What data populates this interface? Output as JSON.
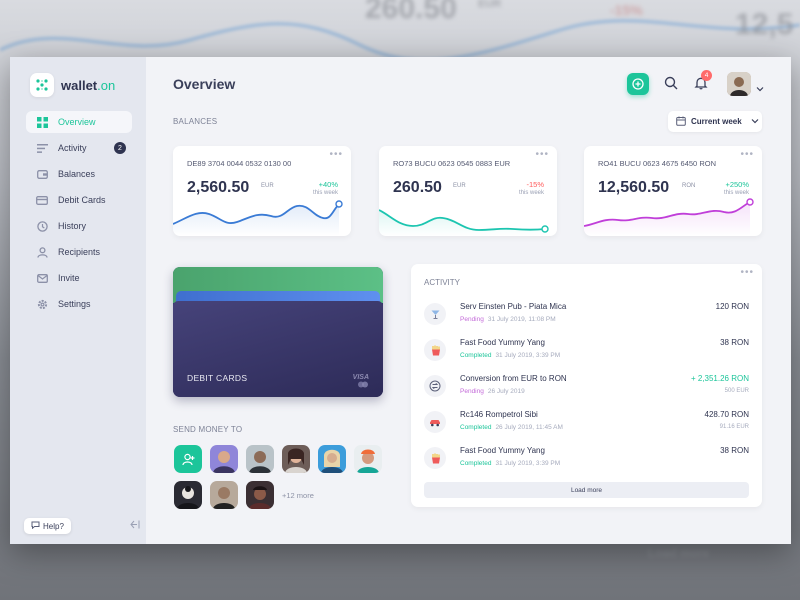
{
  "backdrop": {
    "texts": [
      "260.50",
      "EUR",
      "-15%",
      "12,5",
      "Load more"
    ]
  },
  "app": {
    "logo_name": "wallet",
    "logo_suffix": ".on"
  },
  "sidebar": {
    "items": [
      {
        "label": "Overview",
        "icon": "grid-icon",
        "active": true
      },
      {
        "label": "Activity",
        "icon": "activity-icon",
        "badge": "2"
      },
      {
        "label": "Balances",
        "icon": "wallet-icon"
      },
      {
        "label": "Debit Cards",
        "icon": "card-icon"
      },
      {
        "label": "History",
        "icon": "history-icon"
      },
      {
        "label": "Recipients",
        "icon": "user-icon"
      },
      {
        "label": "Invite",
        "icon": "mail-icon"
      },
      {
        "label": "Settings",
        "icon": "gear-icon"
      }
    ],
    "help_label": "Help?"
  },
  "header": {
    "title": "Overview",
    "notifications_count": "4"
  },
  "balances": {
    "label": "BALANCES",
    "period": "Current week",
    "cards": [
      {
        "iban": "DE89 3704 0044 0532 0130 00",
        "amount": "2,560.50",
        "currency": "EUR",
        "change": "+40%",
        "period": "this week",
        "color": "#3a7bd5",
        "trend": "up"
      },
      {
        "iban": "RO73 BUCU 0623 0545 0883 EUR",
        "amount": "260.50",
        "currency": "EUR",
        "change": "-15%",
        "period": "this week",
        "color": "#1cc5b0",
        "trend": "down"
      },
      {
        "iban": "RO41 BUCU 0623 4675 6450 RON",
        "amount": "12,560.50",
        "currency": "RON",
        "change": "+250%",
        "period": "this week",
        "color": "#c03fd9",
        "trend": "up"
      }
    ]
  },
  "debit": {
    "label": "DEBIT CARDS",
    "brand": "VISA"
  },
  "send": {
    "label": "SEND MONEY TO",
    "more": "+12 more"
  },
  "activity": {
    "title": "ACTIVITY",
    "rows": [
      {
        "name": "Serv Einsten Pub - Piata Mica",
        "status": "Pending",
        "date": "31 July 2019, 11:08 PM",
        "amount": "120 RON",
        "sub": "",
        "icon": "drink-icon",
        "status_color": "#c46bd9"
      },
      {
        "name": "Fast Food Yummy Yang",
        "status": "Completed",
        "date": "31 July 2019, 3:39 PM",
        "amount": "38 RON",
        "sub": "",
        "icon": "fries-icon",
        "status_color": "#1cc59a"
      },
      {
        "name": "Conversion from EUR to RON",
        "status": "Pending",
        "date": "26 July 2019",
        "amount": "+ 2,351.26 RON",
        "sub": "500 EUR",
        "icon": "exchange-icon",
        "status_color": "#c46bd9",
        "amount_color": "#1cc59a"
      },
      {
        "name": "Rc146 Rompetrol Sibi",
        "status": "Completed",
        "date": "26 July 2019, 11:45 AM",
        "amount": "428.70 RON",
        "sub": "91.16 EUR",
        "icon": "car-icon",
        "status_color": "#1cc59a"
      },
      {
        "name": "Fast Food Yummy Yang",
        "status": "Completed",
        "date": "31 July 2019, 3:39 PM",
        "amount": "38 RON",
        "sub": "",
        "icon": "fries-icon",
        "status_color": "#1cc59a"
      }
    ],
    "load_more": "Load more"
  }
}
